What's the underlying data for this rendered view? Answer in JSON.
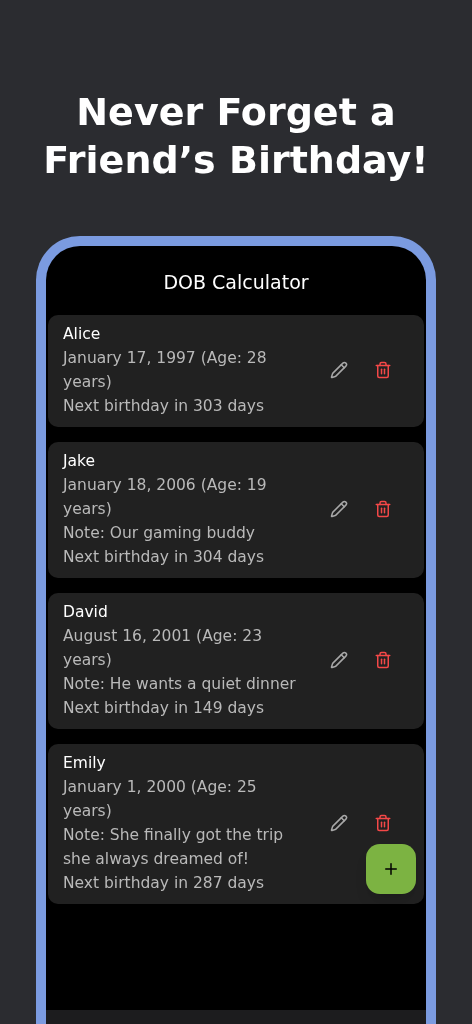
{
  "headline": "Never Forget a Friend’s Birthday!",
  "app_bar": {
    "title": "DOB Calculator"
  },
  "friends": [
    {
      "name": "Alice",
      "dob": "January 17, 1997 (Age: 28 years)",
      "next": "Next birthday in 303 days"
    },
    {
      "name": "Jake",
      "dob": "January 18, 2006 (Age: 19 years)",
      "note": "Note: Our gaming buddy",
      "next": "Next birthday in 304 days"
    },
    {
      "name": "David",
      "dob": "August 16, 2001 (Age: 23 years)",
      "note": "Note: He wants a quiet dinner",
      "next": "Next birthday in 149 days"
    },
    {
      "name": "Emily",
      "dob": "January 1, 2000 (Age: 25 years)",
      "note": "Note: She finally got the trip she always dreamed of!",
      "next": "Next birthday in 287 days"
    }
  ]
}
